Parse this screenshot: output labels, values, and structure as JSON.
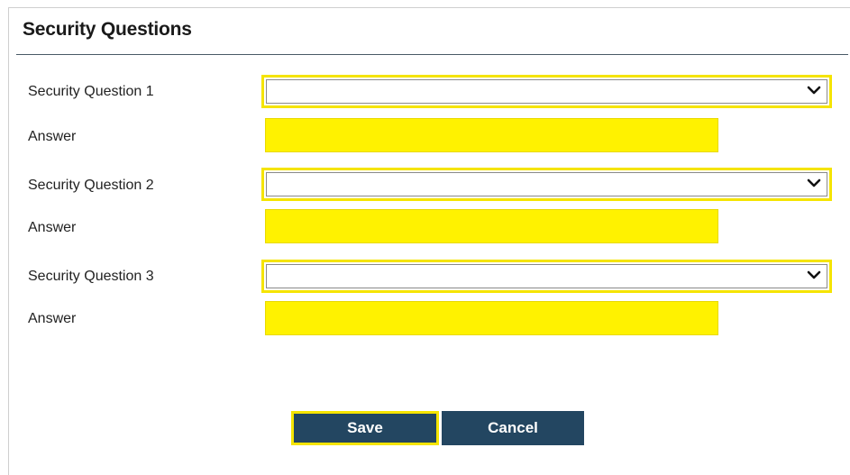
{
  "form": {
    "title": "Security Questions",
    "questions": [
      {
        "label": "Security Question 1",
        "selected": "",
        "answer_label": "Answer",
        "answer_value": ""
      },
      {
        "label": "Security Question 2",
        "selected": "",
        "answer_label": "Answer",
        "answer_value": ""
      },
      {
        "label": "Security Question 3",
        "selected": "",
        "answer_label": "Answer",
        "answer_value": ""
      }
    ],
    "icons": {
      "dropdown": "chevron-down-icon"
    }
  },
  "actions": {
    "save_label": "Save",
    "cancel_label": "Cancel"
  },
  "colors": {
    "highlight": "#f5e400",
    "answer_fill": "#fff200",
    "button_bg": "#234661",
    "button_text": "#ffffff",
    "title_rule": "#4a5a66"
  }
}
